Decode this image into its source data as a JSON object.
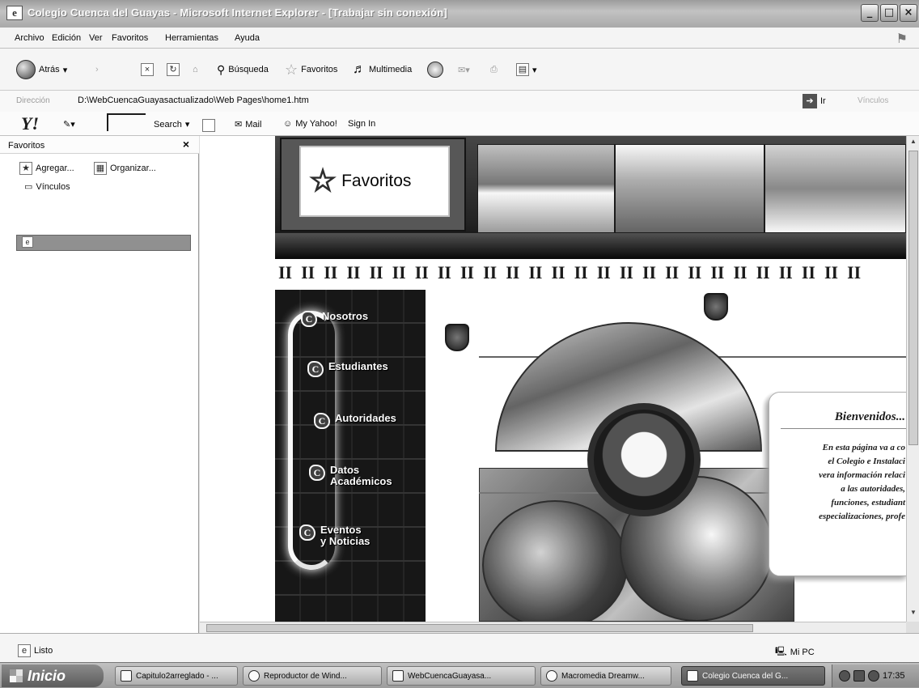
{
  "window": {
    "title": "Colegio Cuenca del Guayas - Microsoft Internet Explorer - [Trabajar sin conexión]"
  },
  "menu": [
    "Archivo",
    "Edición",
    "Ver",
    "Favoritos",
    "Herramientas",
    "Ayuda"
  ],
  "toolbar": {
    "back": "Atrás",
    "search": "Búsqueda",
    "favorites": "Favoritos",
    "media": "Multimedia"
  },
  "address": {
    "label": "Dirección",
    "value": "D:\\WebCuencaGuayasactualizado\\Web Pages\\home1.htm",
    "go": "Ir",
    "links": "Vínculos"
  },
  "yahoo": {
    "logo": "Y!",
    "search": "Search",
    "mail": "Mail",
    "my_yahoo": "My Yahoo!",
    "sign_in": "Sign In"
  },
  "favorites_pane": {
    "title": "Favoritos",
    "close": "×",
    "add": "Agregar...",
    "organize": "Organizar...",
    "folder": "Vínculos"
  },
  "page": {
    "tooltip_label": "Favoritos",
    "nav": [
      {
        "icon": "C",
        "label": "Nosotros"
      },
      {
        "icon": "C",
        "label": "Estudiantes"
      },
      {
        "icon": "C",
        "label": "Autoridades"
      },
      {
        "icon": "C",
        "label": "Datos\nAcadémicos"
      },
      {
        "icon": "C",
        "label": "Eventos\ny Noticias"
      }
    ],
    "welcome_title": "Bienvenidos...",
    "welcome_text": "En esta página va a co\nel Colegio e Instalaci\nvera información relaci\na las autoridades,\nfunciones, estudiant\nespecializaciones, profe"
  },
  "status": {
    "left": "Listo",
    "right": "Mi PC"
  },
  "taskbar": {
    "start": "Inicio",
    "tasks": [
      {
        "label": "Capitulo2arreglado - ...",
        "active": false
      },
      {
        "label": "Reproductor de Wind...",
        "active": false
      },
      {
        "label": "WebCuencaGuayasa...",
        "active": false
      },
      {
        "label": "Macromedia Dreamw...",
        "active": false
      },
      {
        "label": "Colegio Cuenca del G...",
        "active": true
      }
    ],
    "clock": "17:35"
  }
}
